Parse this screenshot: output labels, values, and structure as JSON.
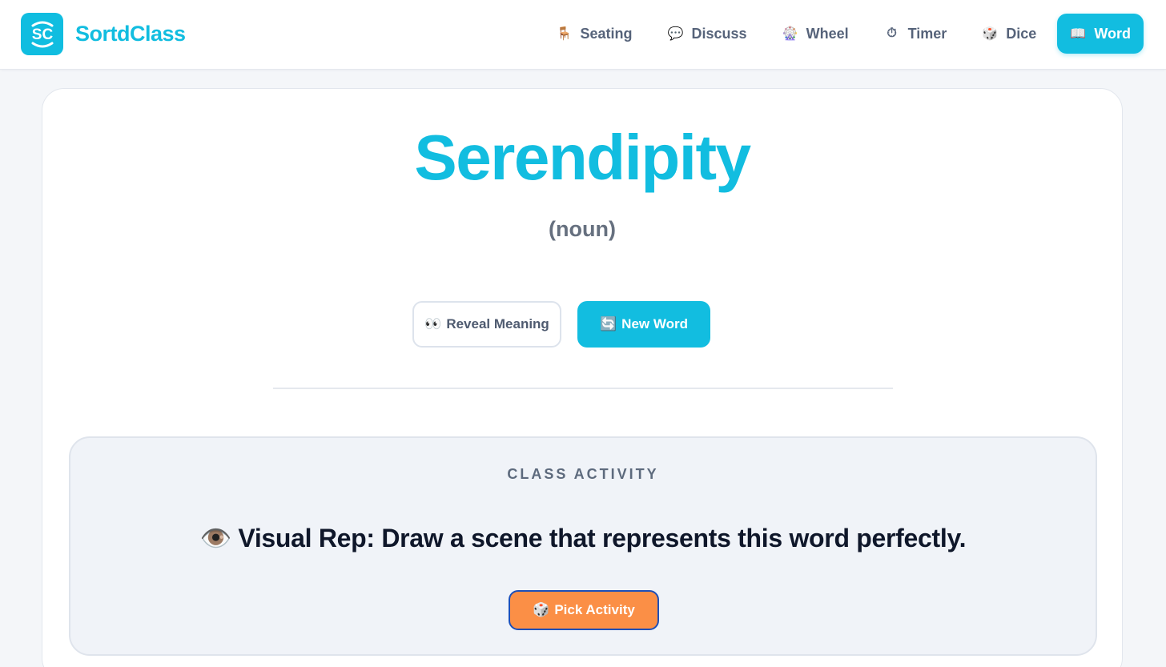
{
  "app": {
    "name": "SortdClass",
    "logo_text": "SC"
  },
  "nav": {
    "items": [
      {
        "label": "Seating",
        "icon": "🪑",
        "icon_name": "chair-icon",
        "active": false
      },
      {
        "label": "Discuss",
        "icon": "💬",
        "icon_name": "speech-bubble-icon",
        "active": false
      },
      {
        "label": "Wheel",
        "icon": "🎡",
        "icon_name": "ferris-wheel-icon",
        "active": false
      },
      {
        "label": "Timer",
        "icon": "⏱",
        "icon_name": "stopwatch-icon",
        "active": false
      },
      {
        "label": "Dice",
        "icon": "🎲",
        "icon_name": "dice-icon",
        "active": false
      },
      {
        "label": "Word",
        "icon": "📖",
        "icon_name": "open-book-icon",
        "active": true
      }
    ]
  },
  "word": {
    "title": "Serendipity",
    "part_of_speech": "(noun)",
    "reveal_icon": "👀",
    "reveal_label": "Reveal Meaning",
    "new_icon": "🔄",
    "new_label": "New Word"
  },
  "activity": {
    "label": "CLASS ACTIVITY",
    "icon": "👁️",
    "text": "Visual Rep: Draw a scene that represents this word perfectly.",
    "pick_icon": "🎲",
    "pick_label": "Pick Activity"
  },
  "colors": {
    "accent": "#12bde0",
    "pick_button": "#fb8f46",
    "pick_button_border": "#1d4fb8",
    "text_dark": "#0f172a",
    "text_muted": "#56637a"
  }
}
